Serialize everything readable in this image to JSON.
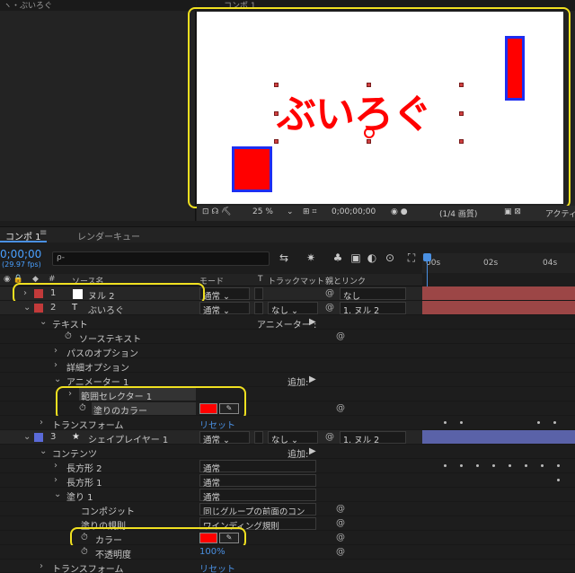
{
  "top_left": {
    "tab": "ヽ・ぶいろぐ"
  },
  "viewer": {
    "tab": "コンポ 1",
    "canvas_text": "ぶいろぐ",
    "zoom": "25 %",
    "timecode": "0;00;00;00",
    "resolution": "(1/4 画質)",
    "active": "アクティブ"
  },
  "tabs": {
    "comp": "コンポ 1",
    "menu": "≡",
    "render": "レンダーキュー"
  },
  "timecode": "0;00;00",
  "fps": "(29.97 fps)",
  "search_placeholder": "ρ-",
  "timeline": {
    "labels": [
      "00s",
      "02s",
      "04s"
    ]
  },
  "header": {
    "label_col": "#",
    "source_name": "ソース名",
    "mode": "モード",
    "t": "T",
    "track_matte": "トラックマット",
    "parent": "親とリンク"
  },
  "layers": [
    {
      "num": "1",
      "name": "ヌル 2",
      "mode": "通常",
      "parent": "なし",
      "color": "#c23a3a"
    },
    {
      "num": "2",
      "name": "ぶいろぐ",
      "mode": "通常",
      "matte": "なし",
      "parent": "1. ヌル 2",
      "color": "#c23a3a"
    },
    {
      "num": "3",
      "name": "シェイプレイヤー 1",
      "mode": "通常",
      "matte": "なし",
      "parent": "1. ヌル 2",
      "color": "#5a6ad8"
    }
  ],
  "props": {
    "text": "テキスト",
    "animator_label": "アニメーター :",
    "source_text": "ソーステキスト",
    "path_options": "パスのオプション",
    "more_options": "詳細オプション",
    "animator1": "アニメーター 1",
    "add": "追加:",
    "range_selector": "範囲セレクター 1",
    "fill_color": "塗りのカラー",
    "transform": "トランスフォーム",
    "reset": "リセット",
    "contents": "コンテンツ",
    "rect2": "長方形 2",
    "rect1": "長方形 1",
    "fill1": "塗り 1",
    "composite": "コンポジット",
    "composite_value": "同じグループの前面のコン",
    "fill_rule": "塗りの規則",
    "fill_rule_value": "ワインディング規則",
    "color": "カラー",
    "opacity": "不透明度",
    "opacity_value": "100%",
    "normal": "通常"
  }
}
